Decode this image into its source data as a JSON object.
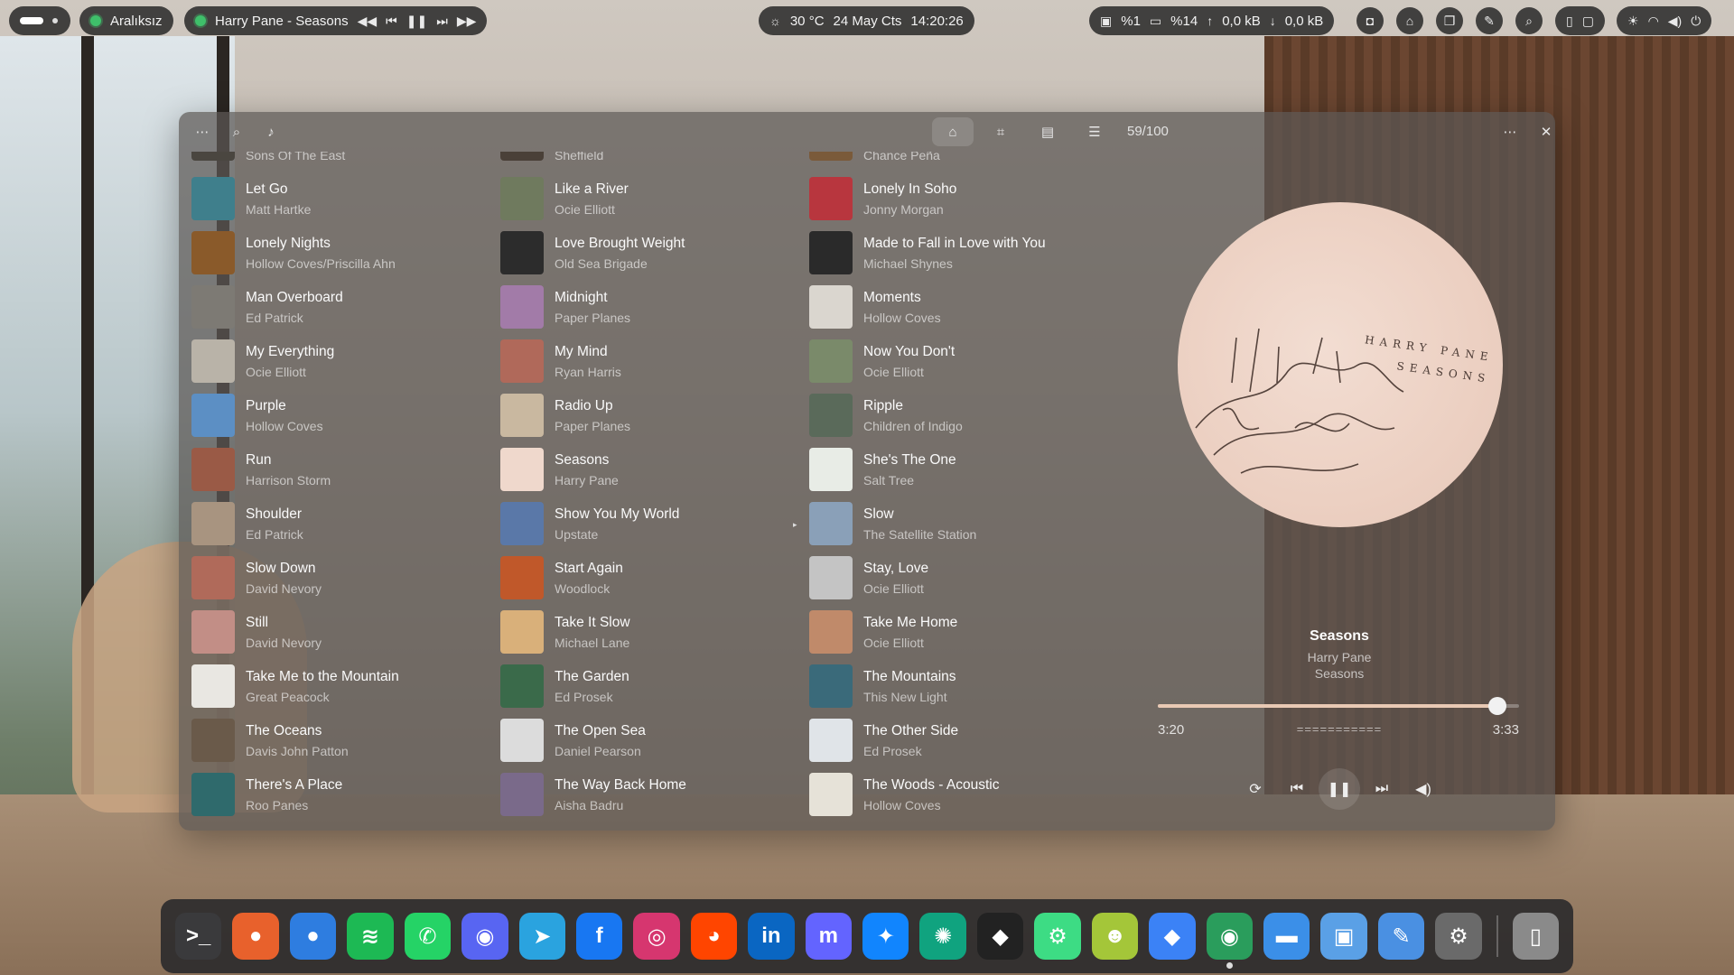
{
  "topbar": {
    "workspace_label": "Aralıksız",
    "now_playing": "Harry Pane - Seasons",
    "weather": "30 °C",
    "date": "24 May Cts",
    "time": "14:20:26",
    "cpu": "%1",
    "ram": "%14",
    "net_up": "0,0 kB",
    "net_down": "0,0 kB"
  },
  "player": {
    "counter": "59/100",
    "columns": [
      [
        {
          "title": "",
          "artist": "Sons Of The East",
          "color": "#4a4640"
        },
        {
          "title": "Let Go",
          "artist": "Matt Hartke",
          "color": "#3f7f8c"
        },
        {
          "title": "Lonely Nights",
          "artist": "Hollow Coves/Priscilla Ahn",
          "color": "#8a5a2a"
        },
        {
          "title": "Man Overboard",
          "artist": "Ed Patrick",
          "color": "#7d7a74"
        },
        {
          "title": "My Everything",
          "artist": "Ocie Elliott",
          "color": "#b9b3a8"
        },
        {
          "title": "Purple",
          "artist": "Hollow Coves",
          "color": "#5c8fc4"
        },
        {
          "title": "Run",
          "artist": "Harrison Storm",
          "color": "#9a5a46"
        },
        {
          "title": "Shoulder",
          "artist": "Ed Patrick",
          "color": "#a89480"
        },
        {
          "title": "Slow Down",
          "artist": "David Nevory",
          "color": "#b06a5a"
        },
        {
          "title": "Still",
          "artist": "David Nevory",
          "color": "#c28e86"
        },
        {
          "title": "Take Me to the Mountain",
          "artist": "Great Peacock",
          "color": "#e9e7e2"
        },
        {
          "title": "The Oceans",
          "artist": "Davis John Patton",
          "color": "#6a5a4a"
        },
        {
          "title": "There's A Place",
          "artist": "Roo Panes",
          "color": "#2f6a6c"
        }
      ],
      [
        {
          "title": "",
          "artist": "Sheffield",
          "color": "#4a4038"
        },
        {
          "title": "Like a River",
          "artist": "Ocie Elliott",
          "color": "#6f7a5e"
        },
        {
          "title": "Love Brought Weight",
          "artist": "Old Sea Brigade",
          "color": "#2c2c2c"
        },
        {
          "title": "Midnight",
          "artist": "Paper Planes",
          "color": "#a27ba8"
        },
        {
          "title": "My Mind",
          "artist": "Ryan Harris",
          "color": "#b0695a"
        },
        {
          "title": "Radio Up",
          "artist": "Paper Planes",
          "color": "#c9b8a0"
        },
        {
          "title": "Seasons",
          "artist": "Harry Pane",
          "color": "#efd8cc"
        },
        {
          "title": "Show You My World",
          "artist": "Upstate",
          "color": "#5a78a8"
        },
        {
          "title": "Start Again",
          "artist": "Woodlock",
          "color": "#c0582a"
        },
        {
          "title": "Take It Slow",
          "artist": "Michael Lane",
          "color": "#d9b07a"
        },
        {
          "title": "The Garden",
          "artist": "Ed Prosek",
          "color": "#3a6a4a"
        },
        {
          "title": "The Open Sea",
          "artist": "Daniel Pearson",
          "color": "#dcdcdc"
        },
        {
          "title": "The Way Back Home",
          "artist": "Aisha Badru",
          "color": "#7a6a8a"
        }
      ],
      [
        {
          "title": "",
          "artist": "Chance Peña",
          "color": "#7a5a3a"
        },
        {
          "title": "Lonely In Soho",
          "artist": "Jonny Morgan",
          "color": "#b8363e"
        },
        {
          "title": "Made to Fall in Love with You",
          "artist": "Michael Shynes",
          "color": "#2a2a2a"
        },
        {
          "title": "Moments",
          "artist": "Hollow Coves",
          "color": "#dad6cf"
        },
        {
          "title": "Now You Don't",
          "artist": "Ocie Elliott",
          "color": "#7a8a6a"
        },
        {
          "title": "Ripple",
          "artist": "Children of Indigo",
          "color": "#5a6a5a"
        },
        {
          "title": "She's The One",
          "artist": "Salt Tree",
          "color": "#e8ece6"
        },
        {
          "title": "Slow",
          "artist": "The Satellite Station",
          "color": "#8aa0b8"
        },
        {
          "title": "Stay, Love",
          "artist": "Ocie Elliott",
          "color": "#c4c4c4"
        },
        {
          "title": "Take Me Home",
          "artist": "Ocie Elliott",
          "color": "#c08a6a"
        },
        {
          "title": "The Mountains",
          "artist": "This New Light",
          "color": "#3a6a7a"
        },
        {
          "title": "The Other Side",
          "artist": "Ed Prosek",
          "color": "#e0e4e8"
        },
        {
          "title": "The Woods - Acoustic",
          "artist": "Hollow Coves",
          "color": "#e6e2d8"
        }
      ]
    ],
    "now_playing": {
      "title": "Seasons",
      "artist": "Harry Pane",
      "album": "Seasons",
      "cover_text_1": "HARRY PANE",
      "cover_text_2": "SEASONS",
      "elapsed": "3:20",
      "total": "3:33",
      "progress": 0.94,
      "eq": "==========="
    }
  },
  "dock": {
    "apps": [
      {
        "name": "terminal",
        "glyph": ">_",
        "bg": "#3a3a3c",
        "running": false
      },
      {
        "name": "firefox",
        "glyph": "●",
        "bg": "#e8612c",
        "running": false
      },
      {
        "name": "thunderbird",
        "glyph": "●",
        "bg": "#2e7de0",
        "running": false
      },
      {
        "name": "spotify",
        "glyph": "≋",
        "bg": "#1db954",
        "running": false
      },
      {
        "name": "whatsapp",
        "glyph": "✆",
        "bg": "#25d366",
        "running": false
      },
      {
        "name": "discord",
        "glyph": "◉",
        "bg": "#5865f2",
        "running": false
      },
      {
        "name": "telegram",
        "glyph": "➤",
        "bg": "#2aa3df",
        "running": false
      },
      {
        "name": "facebook",
        "glyph": "f",
        "bg": "#1877f2",
        "running": false
      },
      {
        "name": "instagram",
        "glyph": "◎",
        "bg": "#d6366f",
        "running": false
      },
      {
        "name": "reddit",
        "glyph": "◕",
        "bg": "#ff4500",
        "running": false
      },
      {
        "name": "linkedin",
        "glyph": "in",
        "bg": "#0a66c2",
        "running": false
      },
      {
        "name": "mastodon",
        "glyph": "m",
        "bg": "#6364ff",
        "running": false
      },
      {
        "name": "bluesky",
        "glyph": "✦",
        "bg": "#1185fe",
        "running": false
      },
      {
        "name": "chatgpt",
        "glyph": "✺",
        "bg": "#10a37f",
        "running": false
      },
      {
        "name": "cube-app",
        "glyph": "◆",
        "bg": "#222222",
        "running": false
      },
      {
        "name": "android-studio",
        "glyph": "⚙",
        "bg": "#3ddc84",
        "running": false
      },
      {
        "name": "android-app",
        "glyph": "☻",
        "bg": "#a4c639",
        "running": false
      },
      {
        "name": "drop-app",
        "glyph": "◆",
        "bg": "#3b82f6",
        "running": false
      },
      {
        "name": "music-player",
        "glyph": "◉",
        "bg": "#2a9d5c",
        "running": true
      },
      {
        "name": "files",
        "glyph": "▬",
        "bg": "#3b8fe8",
        "running": false
      },
      {
        "name": "store",
        "glyph": "▣",
        "bg": "#5aa0e6",
        "running": false
      },
      {
        "name": "editor",
        "glyph": "✎",
        "bg": "#4a90e2",
        "running": false
      },
      {
        "name": "settings",
        "glyph": "⚙",
        "bg": "#6a6a6a",
        "running": false
      },
      {
        "name": "trash",
        "glyph": "▯",
        "bg": "#8a8a8a",
        "running": false
      }
    ]
  }
}
